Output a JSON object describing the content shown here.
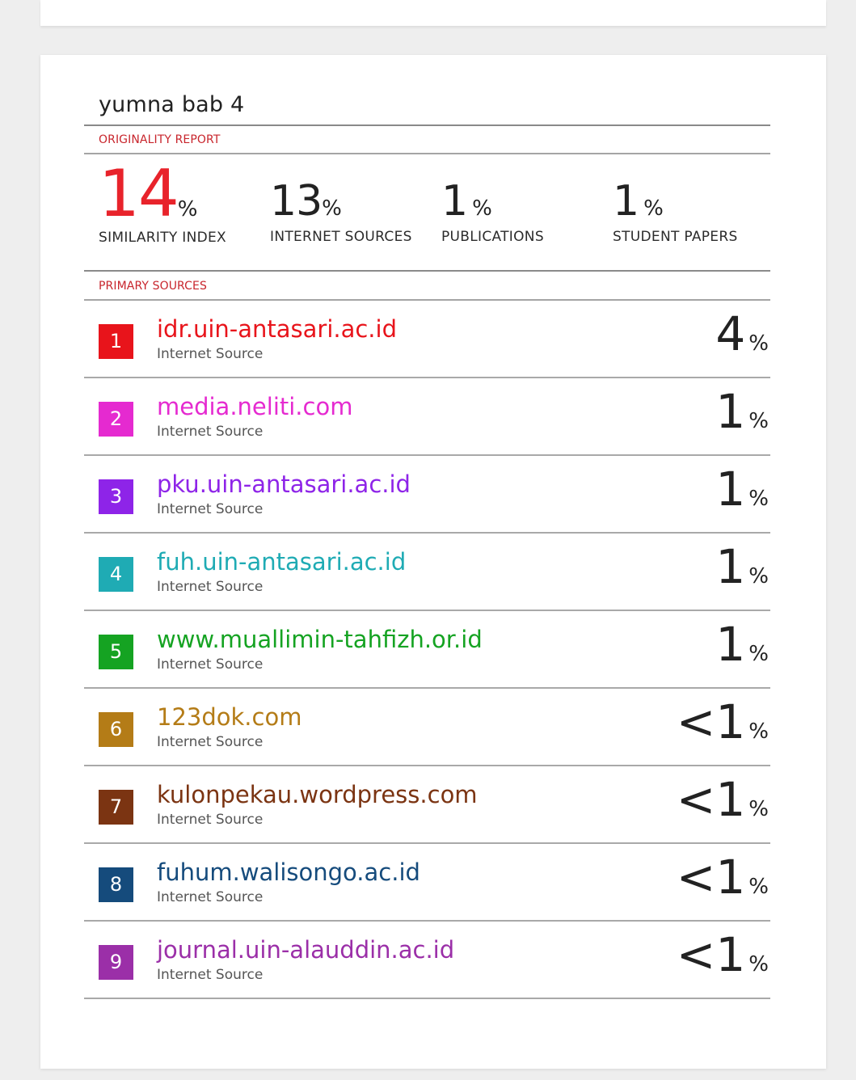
{
  "report": {
    "title": "yumna bab 4",
    "originality_label": "ORIGINALITY REPORT",
    "primary_sources_label": "PRIMARY SOURCES",
    "pct_symbol": "%"
  },
  "stats": [
    {
      "value": "14",
      "label": "SIMILARITY INDEX"
    },
    {
      "value": "13",
      "label": "INTERNET SOURCES"
    },
    {
      "value": "1",
      "label": "PUBLICATIONS"
    },
    {
      "value": "1",
      "label": "STUDENT PAPERS"
    }
  ],
  "sources": [
    {
      "rank": "1",
      "name": "idr.uin-antasari.ac.id",
      "type": "Internet Source",
      "percent": "4",
      "color": "#e8141b"
    },
    {
      "rank": "2",
      "name": "media.neliti.com",
      "type": "Internet Source",
      "percent": "1",
      "color": "#e52ad0"
    },
    {
      "rank": "3",
      "name": "pku.uin-antasari.ac.id",
      "type": "Internet Source",
      "percent": "1",
      "color": "#8e24e8"
    },
    {
      "rank": "4",
      "name": "fuh.uin-antasari.ac.id",
      "type": "Internet Source",
      "percent": "1",
      "color": "#1fabb4"
    },
    {
      "rank": "5",
      "name": "www.muallimin-tahfizh.or.id",
      "type": "Internet Source",
      "percent": "1",
      "color": "#15a322"
    },
    {
      "rank": "6",
      "name": "123dok.com",
      "type": "Internet Source",
      "percent": "<1",
      "color": "#b47c17"
    },
    {
      "rank": "7",
      "name": "kulonpekau.wordpress.com",
      "type": "Internet Source",
      "percent": "<1",
      "color": "#7b3412"
    },
    {
      "rank": "8",
      "name": "fuhum.walisongo.ac.id",
      "type": "Internet Source",
      "percent": "<1",
      "color": "#154b7c"
    },
    {
      "rank": "9",
      "name": "journal.uin-alauddin.ac.id",
      "type": "Internet Source",
      "percent": "<1",
      "color": "#9b2fa8"
    }
  ]
}
